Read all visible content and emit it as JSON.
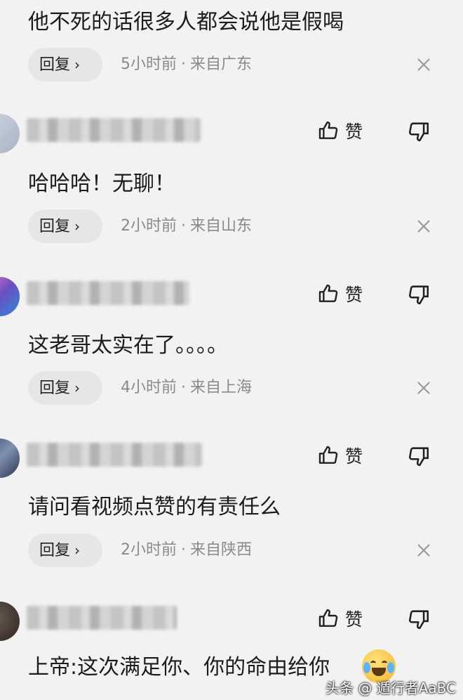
{
  "comments": [
    {
      "text": "他不死的话很多人都会说他是假喝",
      "reply_label": "回复",
      "time": "5小时前",
      "location": "来自广东"
    },
    {
      "text": "哈哈哈！无聊！",
      "reply_label": "回复",
      "time": "2小时前",
      "location": "来自山东",
      "like_label": "赞"
    },
    {
      "text": "这老哥太实在了。。。。",
      "reply_label": "回复",
      "time": "4小时前",
      "location": "来自上海",
      "like_label": "赞"
    },
    {
      "text": "请问看视频点赞的有责任么",
      "reply_label": "回复",
      "time": "2小时前",
      "location": "来自陕西",
      "like_label": "赞"
    },
    {
      "text": "上帝:这次满足你、你的命由给你",
      "like_label": "赞"
    }
  ],
  "meta_separator": "·",
  "watermark": "头条 @ 遁行者AaBC",
  "colors": {
    "background": "#f2f2f2",
    "meta_text": "#8a8a8a",
    "reply_bg": "#e6e6e6"
  },
  "icons": {
    "like": "thumbs-up-icon",
    "dislike": "thumbs-down-icon",
    "close": "close-icon",
    "reply_chevron": "chevron-right-icon"
  }
}
